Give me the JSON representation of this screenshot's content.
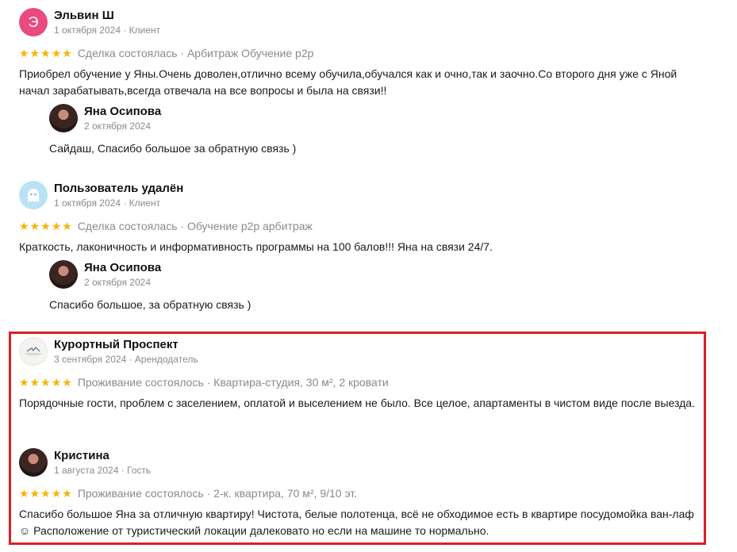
{
  "reviews": [
    {
      "name": "Эльвин Ш",
      "avatar_letter": "Э",
      "date": "1 октября 2024",
      "role": "Клиент",
      "meta": "1 октября 2024 · Клиент",
      "rating": 5,
      "deal": "Сделка состоялась · Арбитраж Обучение p2p",
      "text": "Приобрел обучение у Яны.Очень доволен,отлично всему обучила,обучался как и очно,так и заочно.Со второго дня уже с Яной начал зарабатывать,всегда отвечала на все вопросы и была на связи!!",
      "reply": {
        "name": "Яна Осипова",
        "date": "2 октября 2024",
        "text": "Сайдаш, Спасибо большое за обратную связь )"
      }
    },
    {
      "name": "Пользователь удалён",
      "date": "1 октября 2024",
      "role": "Клиент",
      "meta": "1 октября 2024 · Клиент",
      "rating": 5,
      "deal": "Сделка состоялась · Обучение p2p арбитраж",
      "text": "Краткость, лаконичность и информативность программы на 100 балов!!! Яна на связи 24/7.",
      "reply": {
        "name": "Яна Осипова",
        "date": "2 октября 2024",
        "text": "Спасибо большое, за обратную связь )"
      }
    },
    {
      "name": "Курортный Проспект",
      "date": "3 сентября 2024",
      "role": "Арендодатель",
      "meta": "3 сентября 2024 · Арендодатель",
      "rating": 5,
      "deal": "Проживание состоялось · Квартира-студия, 30 м², 2 кровати",
      "text": "Порядочные гости, проблем с заселением, оплатой и выселением не было. Все целое, апартаменты в чистом виде после выезда."
    },
    {
      "name": "Кристина",
      "date": "1 августа 2024",
      "role": "Гость",
      "meta": "1 августа 2024 · Гость",
      "rating": 5,
      "deal": "Проживание состоялось · 2-к. квартира, 70 м², 9/10 эт.",
      "text": "Спасибо большое Яна за отличную квартиру! Чистота, белые полотенца, всё не обходимое есть в квартире посудомойка ван-лаф ☺ Расположение от туристический локации далековато но если на машине то нормально."
    }
  ],
  "colors": {
    "star": "#f5b400",
    "highlight_border": "#dd1f26",
    "muted_text": "#8a8a8a"
  }
}
